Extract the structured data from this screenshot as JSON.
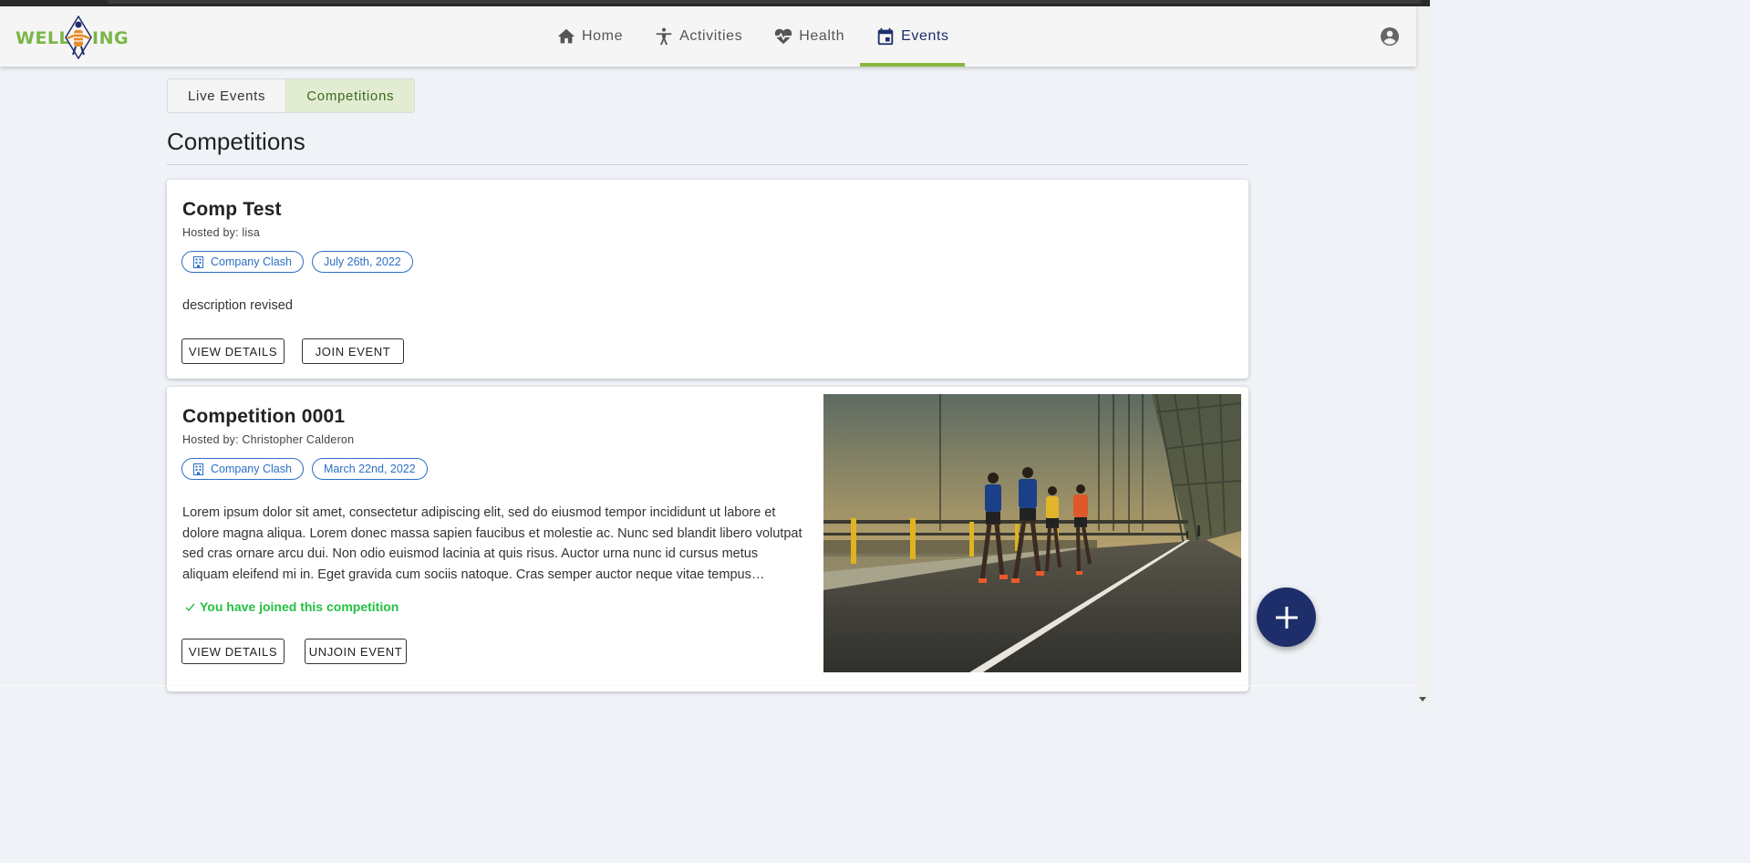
{
  "app": {
    "logo_left": "WELL",
    "logo_right": "ING"
  },
  "nav": {
    "items": [
      {
        "label": "Home",
        "icon": "home-icon"
      },
      {
        "label": "Activities",
        "icon": "activities-icon"
      },
      {
        "label": "Health",
        "icon": "heart-pulse-icon"
      },
      {
        "label": "Events",
        "icon": "calendar-icon",
        "active": true
      }
    ]
  },
  "tabs": [
    {
      "label": "Live Events"
    },
    {
      "label": "Competitions",
      "active": true
    }
  ],
  "page": {
    "title": "Competitions"
  },
  "competitions": [
    {
      "title": "Comp Test",
      "host": "Hosted by: lisa",
      "type_chip": "Company Clash",
      "date_chip": "July 26th, 2022",
      "description": "description revised",
      "view_label": "VIEW DETAILS",
      "action_label": "JOIN EVENT"
    },
    {
      "title": "Competition 0001",
      "host": "Hosted by: Christopher Calderon",
      "type_chip": "Company Clash",
      "date_chip": "March 22nd, 2022",
      "description": "Lorem ipsum dolor sit amet, consectetur adipiscing elit, sed do eiusmod tempor incididunt ut labore et dolore magna aliqua. Lorem donec massa sapien faucibus et molestie ac. Nunc sed blandit libero volutpat sed cras ornare arcu dui. Non odio euismod lacinia at quis risus. Auctor urna nunc id cursus metus aliquam eleifend mi in. Eget gravida cum sociis natoque. Cras semper auctor neque vitae tempus…",
      "joined_text": "You have joined this competition",
      "view_label": "VIEW DETAILS",
      "action_label": "UNJOIN EVENT"
    }
  ],
  "colors": {
    "primary": "#1d2e6b",
    "accent_green": "#86b83b",
    "chip_blue": "#2c6fc4",
    "joined_green": "#25c042"
  }
}
